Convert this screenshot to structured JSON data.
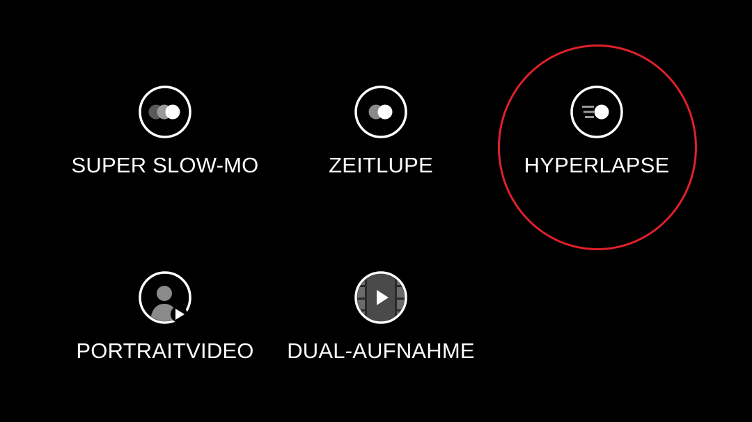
{
  "colors": {
    "background": "#000000",
    "text": "#ffffff",
    "icon_ring": "#ffffff",
    "highlight": "#e0202a"
  },
  "modes": [
    {
      "label": "SUPER SLOW-MO",
      "icon": "super-slow-mo-icon"
    },
    {
      "label": "ZEITLUPE",
      "icon": "slow-motion-icon"
    },
    {
      "label": "HYPERLAPSE",
      "icon": "hyperlapse-icon",
      "highlighted": true
    },
    {
      "label": "PORTRAITVIDEO",
      "icon": "portrait-video-icon"
    },
    {
      "label": "DUAL-AUFNAHME",
      "icon": "dual-recording-icon"
    }
  ]
}
